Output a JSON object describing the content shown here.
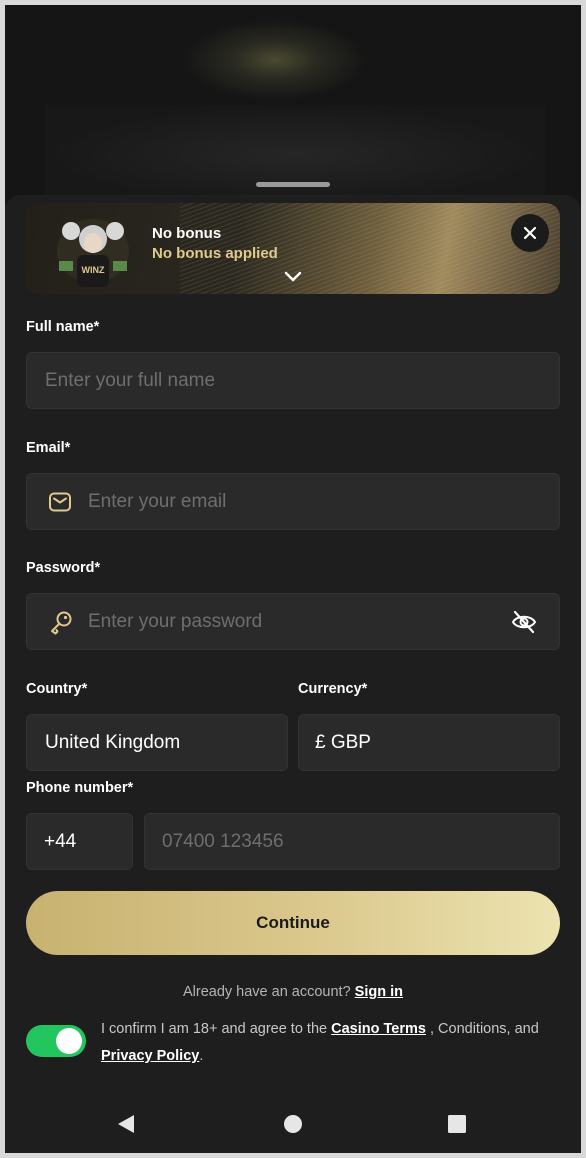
{
  "banner": {
    "title": "No bonus",
    "subtitle": "No bonus applied",
    "mascot_badge": "WINZ"
  },
  "form": {
    "full_name": {
      "label": "Full name*",
      "placeholder": "Enter your full name"
    },
    "email": {
      "label": "Email*",
      "placeholder": "Enter your email"
    },
    "password": {
      "label": "Password*",
      "placeholder": "Enter your password"
    },
    "country": {
      "label": "Country*",
      "value": "United Kingdom"
    },
    "currency": {
      "label": "Currency*",
      "value": "£ GBP"
    },
    "phone": {
      "label": "Phone number*",
      "code": "+44",
      "placeholder": "07400 123456"
    },
    "continue_label": "Continue"
  },
  "account": {
    "prompt": "Already have an account?",
    "signin_label": "Sign in"
  },
  "consent": {
    "toggle_on": true,
    "text_before": "I confirm I am 18+ and agree to the ",
    "casino_terms": "Casino Terms",
    "text_middle": " , Conditions, and ",
    "privacy_policy": "Privacy Policy",
    "text_after": "."
  },
  "colors": {
    "accent_gold": "#e0c98c",
    "toggle_green": "#22c55e",
    "sheet_bg": "#1e1e1e",
    "field_bg": "#2a2a2a"
  },
  "icons": [
    "close-icon",
    "chevron-down-icon",
    "envelope-icon",
    "key-icon",
    "eye-off-icon",
    "back-triangle-icon",
    "home-circle-icon",
    "recents-square-icon"
  ]
}
